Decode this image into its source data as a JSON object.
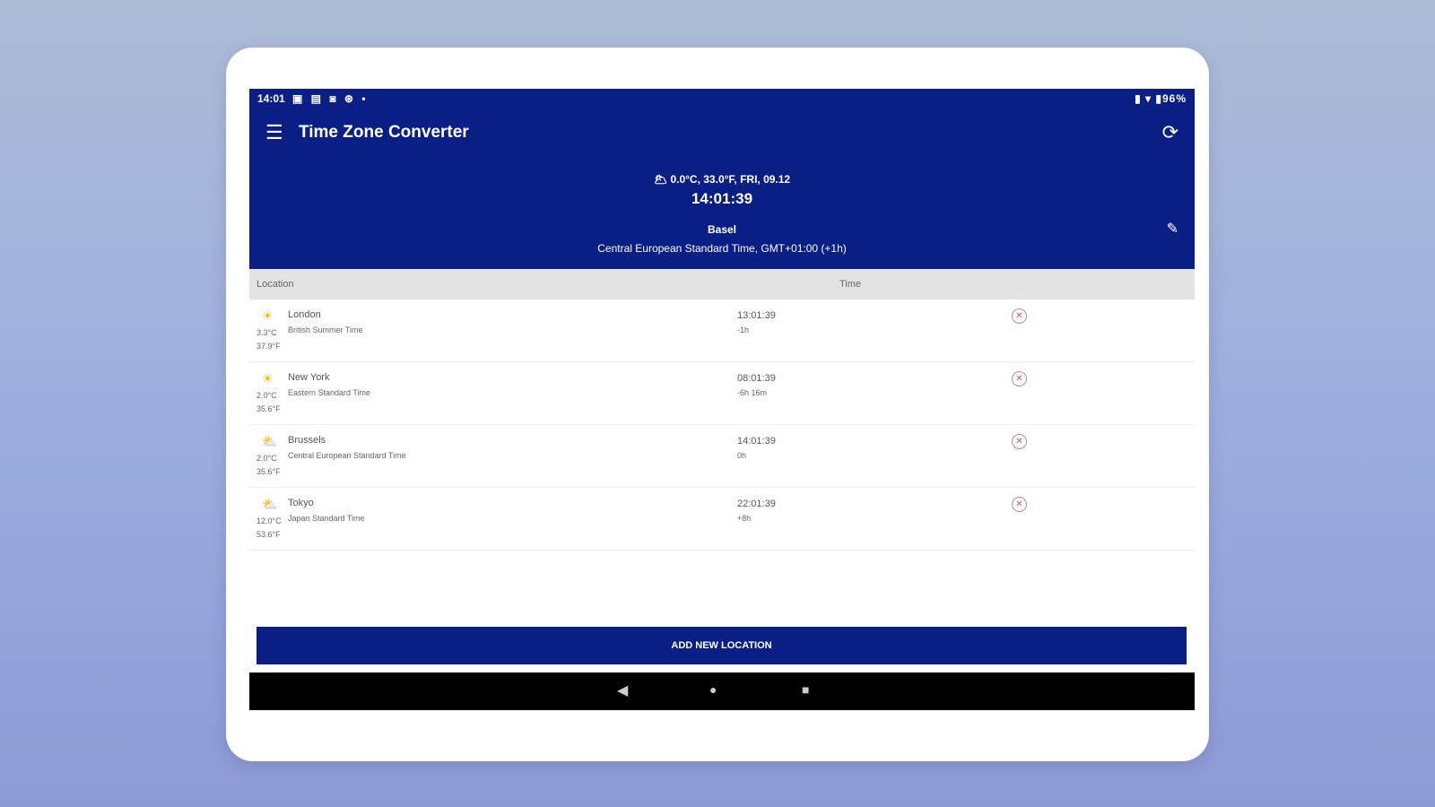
{
  "statusbar": {
    "time": "14:01",
    "icons": "▣ ▤ ◙ ⊛ •",
    "right": "▮ ▾ ▮96%"
  },
  "appbar": {
    "title": "Time Zone Converter",
    "menu_icon": "☰",
    "refresh_icon": "⟳"
  },
  "base": {
    "weather": "🌥 0.0°C, 33.0°F, FRI, 09.12",
    "clock": "14:01:39",
    "city": "Basel",
    "zone": "Central European Standard Time, GMT+01:00 (+1h)",
    "edit_icon": "✎"
  },
  "table": {
    "col_location": "Location",
    "col_time": "Time",
    "rows": [
      {
        "icon": "☀",
        "temp_c": "3.3°C",
        "temp_f": "37.9°F",
        "city": "London",
        "zone": "British Summer Time",
        "time": "13:01:39",
        "offset": "-1h"
      },
      {
        "icon": "☀",
        "temp_c": "2.0°C",
        "temp_f": "35.6°F",
        "city": "New York",
        "zone": "Eastern Standard Time",
        "time": "08:01:39",
        "offset": "-6h 16m"
      },
      {
        "icon": "⛅",
        "temp_c": "2.0°C",
        "temp_f": "35.6°F",
        "city": "Brussels",
        "zone": "Central European Standard Time",
        "time": "14:01:39",
        "offset": "0h"
      },
      {
        "icon": "⛅",
        "temp_c": "12.0°C",
        "temp_f": "53.6°F",
        "city": "Tokyo",
        "zone": "Japan Standard Time",
        "time": "22:01:39",
        "offset": "+8h"
      }
    ]
  },
  "add_button": "ADD NEW LOCATION",
  "nav": {
    "back": "◀",
    "home": "●",
    "recent": "■"
  },
  "colors": {
    "primary": "#0a1f86",
    "remove": "#d9534f"
  }
}
